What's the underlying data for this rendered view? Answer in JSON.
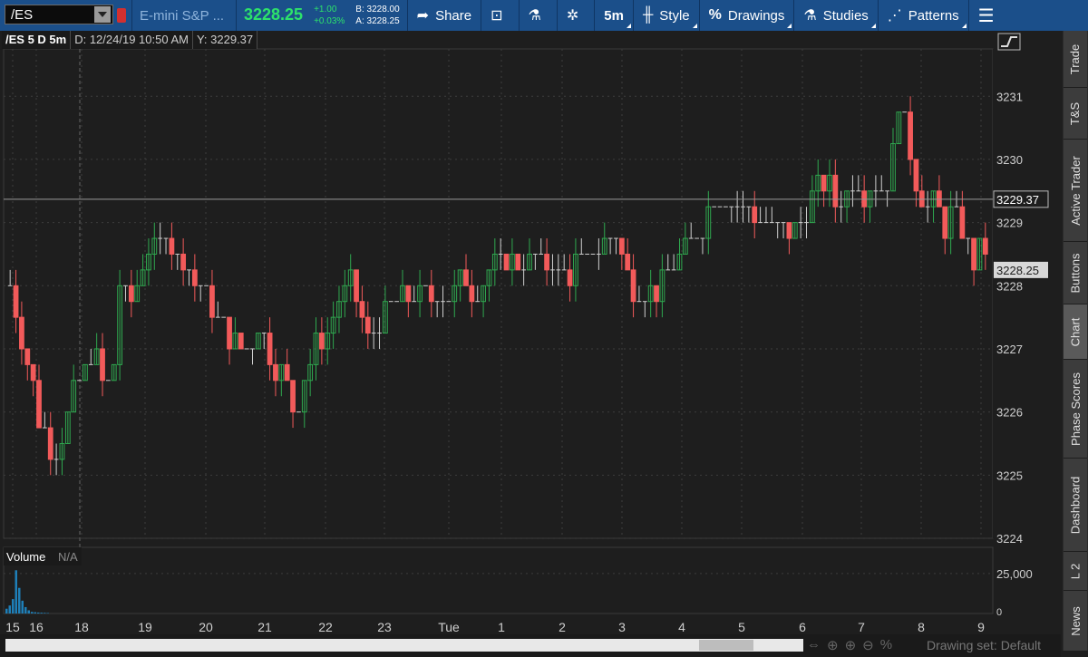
{
  "toolbar": {
    "symbol": "/ES",
    "description": "E-mini S&P ...",
    "last": "3228.25",
    "change": "+1.00",
    "change_pct": "+0.03%",
    "bid": "B: 3228.00",
    "ask": "A: 3228.25",
    "share_label": "Share",
    "timeframe": "5m",
    "style_label": "Style",
    "drawings_label": "Drawings",
    "studies_label": "Studies",
    "patterns_label": "Patterns"
  },
  "info": {
    "symbol": "/ES 5 D 5m",
    "date": "D: 12/24/19 10:50 AM",
    "y": "Y: 3229.37"
  },
  "volume": {
    "label": "Volume",
    "value": "N/A",
    "tick": "25,000",
    "zero": "0"
  },
  "right_tabs": [
    "Trade",
    "T&S",
    "Active Trader",
    "Buttons",
    "Chart",
    "Phase Scores",
    "Dashboard",
    "L 2",
    "News"
  ],
  "footer": {
    "drawing_set": "Drawing set: Default"
  },
  "colors": {
    "up": "#2fa84f",
    "down": "#f25a5a",
    "bg": "#1e1e1e",
    "toolbar": "#1b4f8a"
  },
  "chart_data": {
    "type": "candlestick",
    "price_axis": {
      "ticks": [
        "3231",
        "3230",
        "3229",
        "3228",
        "3227",
        "3226",
        "3225",
        "3224"
      ],
      "range": [
        3224,
        3231.75
      ]
    },
    "time_axis": {
      "ticks": [
        "15",
        "16",
        "18",
        "19",
        "20",
        "21",
        "22",
        "23",
        "Tue",
        "1",
        "2",
        "3",
        "4",
        "5",
        "6",
        "7",
        "8",
        "9"
      ]
    },
    "crosshair_label": "3229.37",
    "last_label": "3228.25",
    "price_path": [
      [
        0,
        3228
      ],
      [
        3,
        3226
      ],
      [
        5,
        3225.3
      ],
      [
        7,
        3226.3
      ],
      [
        9,
        3227
      ],
      [
        11,
        3226.2
      ],
      [
        12,
        3228
      ],
      [
        13,
        3227.5
      ],
      [
        14,
        3228.2
      ],
      [
        16,
        3228.7
      ],
      [
        17,
        3228.9
      ],
      [
        19,
        3228.3
      ],
      [
        21,
        3227.9
      ],
      [
        23,
        3227.4
      ],
      [
        25,
        3226.9
      ],
      [
        27,
        3227.3
      ],
      [
        29,
        3226.8
      ],
      [
        31,
        3226
      ],
      [
        32,
        3226.6
      ],
      [
        33,
        3227
      ],
      [
        35,
        3227.4
      ],
      [
        36,
        3227.7
      ],
      [
        37,
        3228
      ],
      [
        38,
        3227.6
      ],
      [
        39,
        3227.1
      ],
      [
        40,
        3227.4
      ],
      [
        42,
        3227.8
      ],
      [
        47,
        3227.8
      ],
      [
        49,
        3228
      ],
      [
        51,
        3228
      ],
      [
        53,
        3228.4
      ],
      [
        57,
        3228.5
      ],
      [
        60,
        3228.2
      ],
      [
        62,
        3228.3
      ],
      [
        64,
        3228.6
      ],
      [
        66,
        3228.9
      ],
      [
        67,
        3228.2
      ],
      [
        69,
        3227.8
      ],
      [
        71,
        3228
      ],
      [
        73,
        3228.4
      ],
      [
        75,
        3228.8
      ],
      [
        77,
        3229.4
      ],
      [
        80,
        3229.3
      ],
      [
        83,
        3229
      ],
      [
        85,
        3228.9
      ],
      [
        87,
        3229.1
      ],
      [
        88,
        3229.7
      ],
      [
        90,
        3229.4
      ],
      [
        92,
        3229.6
      ],
      [
        95,
        3229.5
      ],
      [
        96,
        3229.9
      ],
      [
        97,
        3230.9
      ],
      [
        98,
        3230.1
      ],
      [
        99,
        3229.6
      ],
      [
        100,
        3229.3
      ],
      [
        101,
        3229.4
      ],
      [
        102,
        3228.8
      ],
      [
        103,
        3229.2
      ],
      [
        104,
        3228.7
      ],
      [
        105,
        3228.3
      ],
      [
        106,
        3228.6
      ],
      [
        107,
        3228.25
      ]
    ],
    "volume_values": [
      3000,
      5000,
      9000,
      27000,
      16000,
      8000,
      4000,
      2000,
      1000,
      800,
      600,
      500,
      400,
      300
    ]
  }
}
